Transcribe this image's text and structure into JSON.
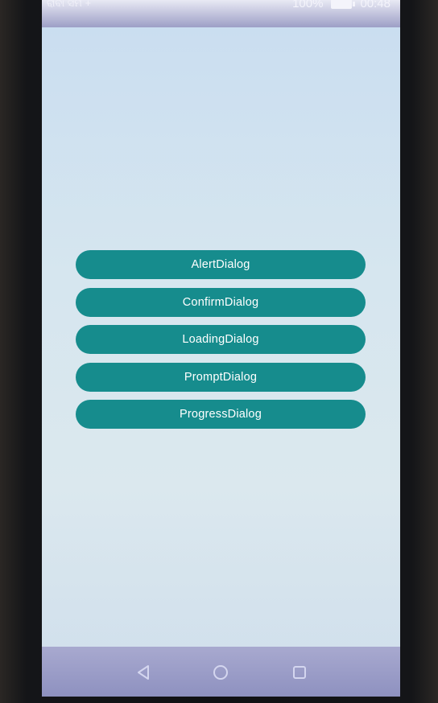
{
  "status_bar": {
    "carrier": "ରାବା ସିମ +",
    "battery": "100%",
    "time": "00:48"
  },
  "dialogs": [
    {
      "label": "AlertDialog"
    },
    {
      "label": "ConfirmDialog"
    },
    {
      "label": "LoadingDialog"
    },
    {
      "label": "PromptDialog"
    },
    {
      "label": "ProgressDialog"
    }
  ],
  "colors": {
    "button_bg": "#168c8d",
    "screen_bg": "#d6e6ef",
    "nav_bar_bg": "#9a9cc8"
  },
  "nav_bar": {
    "icons": [
      "back-icon",
      "home-icon",
      "recent-apps-icon"
    ]
  }
}
